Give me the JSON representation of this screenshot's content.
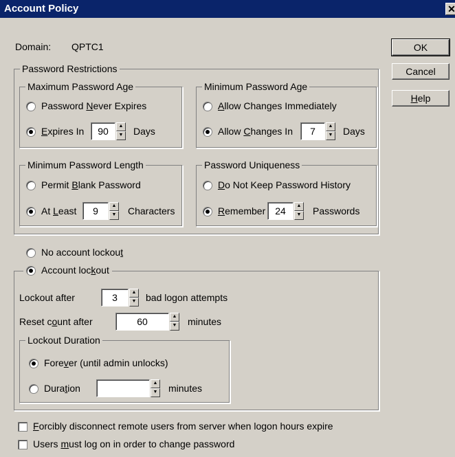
{
  "window": {
    "title": "Account Policy",
    "close": "✕"
  },
  "domain": {
    "label": "Domain:",
    "value": "QPTC1"
  },
  "buttons": {
    "ok": "OK",
    "cancel": "Cancel",
    "help_pre": "",
    "help_u": "H",
    "help_post": "elp"
  },
  "password_restrictions": {
    "title": "Password Restrictions",
    "max_age": {
      "title": "Maximum Password Age",
      "never_pre": "Password ",
      "never_u": "N",
      "never_post": "ever Expires",
      "expires_pre": "",
      "expires_u": "E",
      "expires_post": "xpires In",
      "days_value": "90",
      "days_unit": "Days",
      "selected": "expires"
    },
    "min_age": {
      "title": "Minimum Password Age",
      "immediate_pre": "",
      "immediate_u": "A",
      "immediate_post": "llow Changes Immediately",
      "allow_pre": "Allow ",
      "allow_u": "C",
      "allow_post": "hanges In",
      "days_value": "7",
      "days_unit": "Days",
      "selected": "allow"
    },
    "min_length": {
      "title": "Minimum Password Length",
      "blank_pre": "Permit ",
      "blank_u": "B",
      "blank_post": "lank Password",
      "atleast_pre": "At ",
      "atleast_u": "L",
      "atleast_post": "east",
      "chars_value": "9",
      "chars_unit": "Characters",
      "selected": "atleast"
    },
    "uniqueness": {
      "title": "Password Uniqueness",
      "nokeep_pre": "",
      "nokeep_u": "D",
      "nokeep_post": "o Not Keep Password History",
      "remember_pre": "",
      "remember_u": "R",
      "remember_post": "emember",
      "pw_value": "24",
      "pw_unit": "Passwords",
      "selected": "remember"
    }
  },
  "lockout": {
    "no_lockout_pre": "No account lockou",
    "no_lockout_u": "t",
    "no_lockout_post": "",
    "lockout_pre": "Account loc",
    "lockout_u": "k",
    "lockout_post": "out",
    "selected": "lockout",
    "after_label": "Lockout after",
    "after_value": "3",
    "after_suffix_pre": "bad lo",
    "after_suffix_u": "g",
    "after_suffix_post": "on attempts",
    "reset_pre": "Reset c",
    "reset_u": "o",
    "reset_post": "unt after",
    "reset_value": "60",
    "reset_unit": "minutes",
    "duration": {
      "title": "Lockout Duration",
      "forever_pre": "Fore",
      "forever_u": "v",
      "forever_post": "er (until admin unlocks)",
      "duration_pre": "Dura",
      "duration_u": "t",
      "duration_post": "ion",
      "duration_value": "",
      "duration_unit": "minutes",
      "selected": "forever"
    }
  },
  "checkboxes": {
    "disconnect_pre": "",
    "disconnect_u": "F",
    "disconnect_post": "orcibly disconnect remote users from server when logon hours expire",
    "disconnect_checked": false,
    "logon_pre": "Users ",
    "logon_u": "m",
    "logon_post": "ust log on in order to change password",
    "logon_checked": false
  }
}
